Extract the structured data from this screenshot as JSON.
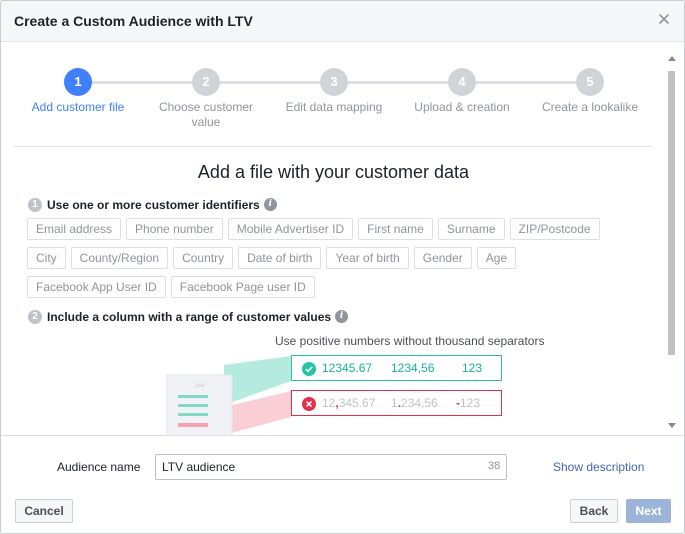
{
  "dialog": {
    "title": "Create a Custom Audience with LTV"
  },
  "steps": [
    {
      "number": "1",
      "label": "Add customer file",
      "active": true
    },
    {
      "number": "2",
      "label": "Choose customer value",
      "active": false
    },
    {
      "number": "3",
      "label": "Edit data mapping",
      "active": false
    },
    {
      "number": "4",
      "label": "Upload & creation",
      "active": false
    },
    {
      "number": "5",
      "label": "Create a lookalike",
      "active": false
    }
  ],
  "main": {
    "title": "Add a file with your customer data",
    "section1": {
      "number": "1",
      "label": "Use one or more customer identifiers",
      "tags": [
        [
          "Email address",
          "Phone number",
          "Mobile Advertiser ID",
          "First name",
          "Surname",
          "ZIP/Postcode"
        ],
        [
          "City",
          "County/Region",
          "Country",
          "Date of birth",
          "Year of birth",
          "Gender",
          "Age"
        ],
        [
          "Facebook App User ID",
          "Facebook Page user ID"
        ]
      ]
    },
    "section2": {
      "number": "2",
      "label": "Include a column with a range of customer values",
      "hint": "Use positive numbers without thousand separators",
      "good_values": [
        "12345.67",
        "1234,56",
        "123"
      ],
      "bad_values": [
        {
          "pre": "12",
          "mark": ",",
          "post": "345.67"
        },
        {
          "pre": "1",
          "mark": ".",
          "post": "234,56"
        },
        {
          "pre": "",
          "mark": "-",
          "post": "123"
        }
      ],
      "file_label": ".csv"
    }
  },
  "footer": {
    "audience_label": "Audience name",
    "audience_value": "LTV audience",
    "char_count": "38",
    "show_description": "Show description",
    "cancel": "Cancel",
    "back": "Back",
    "next": "Next"
  },
  "colors": {
    "accent": "#4080ff",
    "good": "#29c2a4",
    "bad": "#e0314a",
    "next_disabled": "#9cb4d8"
  }
}
